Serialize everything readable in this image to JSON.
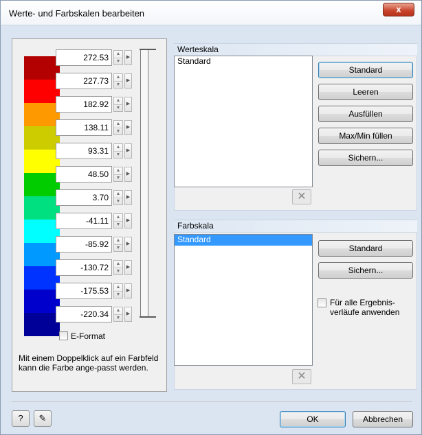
{
  "window": {
    "title": "Werte- und Farbskalen bearbeiten",
    "close_label": "x"
  },
  "scale_rows": [
    {
      "value": "272.53",
      "color": "#b30000"
    },
    {
      "value": "227.73",
      "color": "#ff0000"
    },
    {
      "value": "182.92",
      "color": "#ff9900"
    },
    {
      "value": "138.11",
      "color": "#cccc00"
    },
    {
      "value": "93.31",
      "color": "#ffff00"
    },
    {
      "value": "48.50",
      "color": "#00cc00"
    },
    {
      "value": "3.70",
      "color": "#00e080"
    },
    {
      "value": "-41.11",
      "color": "#00ffff"
    },
    {
      "value": "-85.92",
      "color": "#0099ff"
    },
    {
      "value": "-130.72",
      "color": "#0033ff"
    },
    {
      "value": "-175.53",
      "color": "#0000cc"
    },
    {
      "value": "-220.34",
      "color": "#000099"
    }
  ],
  "left": {
    "eformat_label": "E-Format",
    "hint": "Mit einem Doppelklick auf ein Farbfeld kann die Farbe ange-passt werden."
  },
  "werteskala": {
    "header": "Werteskala",
    "items": [
      "Standard"
    ],
    "buttons": {
      "standard": "Standard",
      "leeren": "Leeren",
      "ausfuellen": "Ausfüllen",
      "maxmin": "Max/Min füllen",
      "sichern": "Sichern..."
    }
  },
  "farbskala": {
    "header": "Farbskala",
    "items": [
      "Standard"
    ],
    "buttons": {
      "standard": "Standard",
      "sichern": "Sichern..."
    },
    "checkbox_label": "Für alle Ergebnis-verläufe anwenden"
  },
  "footer": {
    "ok": "OK",
    "cancel": "Abbrechen"
  }
}
